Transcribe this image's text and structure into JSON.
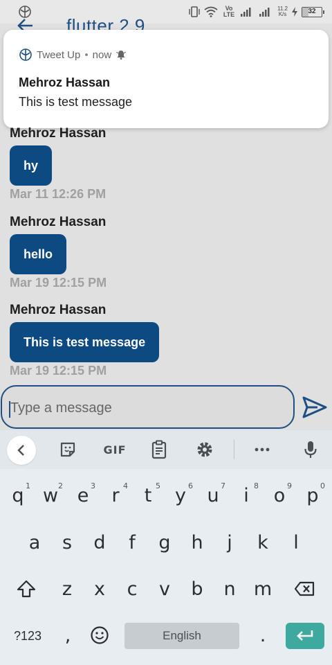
{
  "status_bar": {
    "network_label": "Vo LTE",
    "net_speed": "11.2",
    "net_speed_unit": "K/s",
    "battery": "32",
    "battery_level_percent": 32
  },
  "app_bar": {
    "title": "flutter 2.9"
  },
  "notification": {
    "app_name": "Tweet Up",
    "separator": "•",
    "time": "now",
    "sender": "Mehroz Hassan",
    "body": "This is test message"
  },
  "messages": [
    {
      "sender": "Mehroz Hassan",
      "text": "hy",
      "time": "Mar 11 12:26 PM"
    },
    {
      "sender": "Mehroz Hassan",
      "text": "hello",
      "time": "Mar 19 12:15 PM"
    },
    {
      "sender": "Mehroz Hassan",
      "text": "This is test message",
      "time": "Mar 19 12:15 PM"
    }
  ],
  "composer": {
    "placeholder": "Type a message"
  },
  "keyboard": {
    "toolbar": {
      "gif_label": "GIF"
    },
    "row1": [
      {
        "key": "q",
        "hint": "1"
      },
      {
        "key": "w",
        "hint": "2"
      },
      {
        "key": "e",
        "hint": "3"
      },
      {
        "key": "r",
        "hint": "4"
      },
      {
        "key": "t",
        "hint": "5"
      },
      {
        "key": "y",
        "hint": "6"
      },
      {
        "key": "u",
        "hint": "7"
      },
      {
        "key": "i",
        "hint": "8"
      },
      {
        "key": "o",
        "hint": "9"
      },
      {
        "key": "p",
        "hint": "0"
      }
    ],
    "row2": [
      "a",
      "s",
      "d",
      "f",
      "g",
      "h",
      "j",
      "k",
      "l"
    ],
    "row3": [
      "z",
      "x",
      "c",
      "v",
      "b",
      "n",
      "m"
    ],
    "symbols_label": "?123",
    "comma": ",",
    "space_label": "English",
    "period": "."
  },
  "colors": {
    "accent": "#0e4a82",
    "enter_key": "#3ea99f",
    "timestamp": "#a0a0a0"
  }
}
